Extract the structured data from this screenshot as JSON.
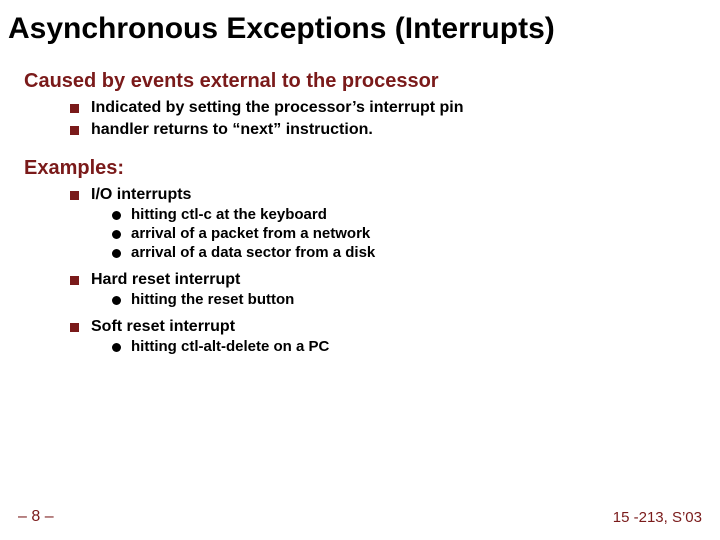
{
  "title": "Asynchronous Exceptions (Interrupts)",
  "sections": [
    {
      "heading": "Caused by events external to the processor",
      "items": [
        {
          "text": "Indicated by setting the processor’s interrupt pin"
        },
        {
          "text": "handler returns to “next” instruction."
        }
      ]
    },
    {
      "heading": "Examples:",
      "items": [
        {
          "text": "I/O interrupts",
          "sub": [
            "hitting ctl-c at the keyboard",
            "arrival of a packet from a network",
            "arrival of a data sector from a disk"
          ]
        },
        {
          "text": "Hard reset interrupt",
          "sub": [
            "hitting the reset button"
          ]
        },
        {
          "text": "Soft reset interrupt",
          "sub": [
            "hitting ctl-alt-delete on a PC"
          ]
        }
      ]
    }
  ],
  "footer": {
    "left": "– 8 –",
    "right": "15 -213, S’03"
  }
}
